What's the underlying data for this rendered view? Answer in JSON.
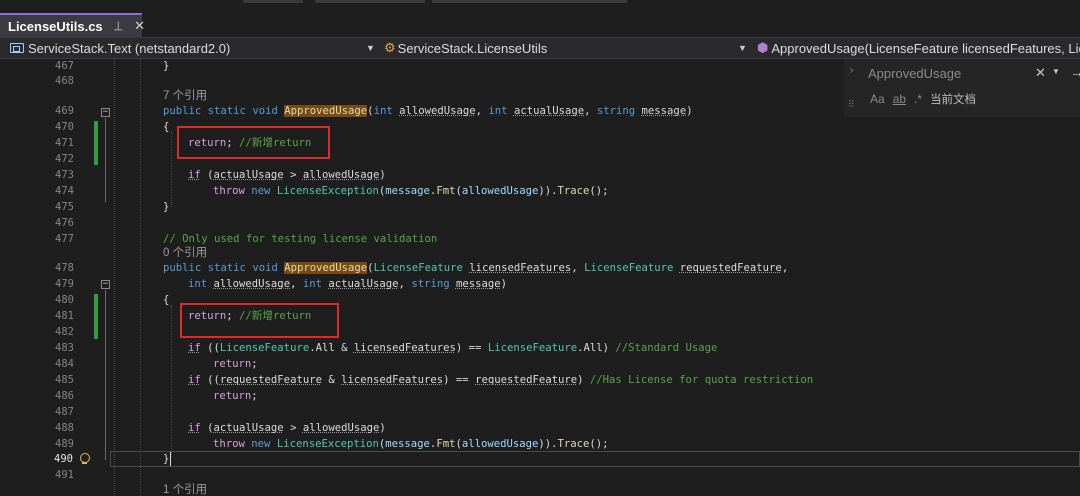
{
  "tab": {
    "title": "LicenseUtils.cs",
    "pin_icon": "pin-icon",
    "close_glyph": "✕"
  },
  "navbar": {
    "project": "ServiceStack.Text (netstandard2.0)",
    "type": "ServiceStack.LicenseUtils",
    "member": "ApprovedUsage(LicenseFeature licensedFeatures, Lic"
  },
  "find_widget": {
    "value": "ApprovedUsage",
    "scope": "当前文档",
    "opt_case": "Aa",
    "opt_word": "ab"
  },
  "code_lines": [
    {
      "num": "467",
      "text": "}",
      "kind": "brace"
    },
    {
      "num": "468",
      "text": "",
      "kind": "blank"
    },
    {
      "lens": "7 个引用"
    },
    {
      "num": "469",
      "text": "public static void ApprovedUsage(int allowedUsage, int actualUsage, string message)"
    },
    {
      "num": "470",
      "text": "{"
    },
    {
      "num": "471",
      "text": "return; //新增return"
    },
    {
      "num": "472",
      "text": ""
    },
    {
      "num": "473",
      "text": "if (actualUsage > allowedUsage)"
    },
    {
      "num": "474",
      "text": "throw new LicenseException(message.Fmt(allowedUsage)).Trace();"
    },
    {
      "num": "475",
      "text": "}"
    },
    {
      "num": "476",
      "text": ""
    },
    {
      "num": "477",
      "text": "// Only used for testing license validation"
    },
    {
      "lens": "0 个引用"
    },
    {
      "num": "478",
      "text": "public static void ApprovedUsage(LicenseFeature licensedFeatures, LicenseFeature requestedFeature,"
    },
    {
      "num": "479",
      "text": "int allowedUsage, int actualUsage, string message)"
    },
    {
      "num": "480",
      "text": "{"
    },
    {
      "num": "481",
      "text": "return; //新增return"
    },
    {
      "num": "482",
      "text": ""
    },
    {
      "num": "483",
      "text": "if ((LicenseFeature.All & licensedFeatures) == LicenseFeature.All) //Standard Usage"
    },
    {
      "num": "484",
      "text": "return;"
    },
    {
      "num": "485",
      "text": "if ((requestedFeature & licensedFeatures) == requestedFeature) //Has License for quota restriction"
    },
    {
      "num": "486",
      "text": "return;"
    },
    {
      "num": "487",
      "text": ""
    },
    {
      "num": "488",
      "text": "if (actualUsage > allowedUsage)"
    },
    {
      "num": "489",
      "text": "throw new LicenseException(message.Fmt(allowedUsage)).Trace();"
    },
    {
      "num": "490",
      "text": "}"
    },
    {
      "num": "491",
      "text": ""
    },
    {
      "lens": "1 个引用"
    }
  ],
  "colors": {
    "modified_bar": "#2ea043",
    "annotation_box": "#e02a2a",
    "find_highlight": "#7a4a16",
    "keyword": "#569cd6",
    "type": "#4ec9b0",
    "comment": "#57a64a"
  },
  "icons": {
    "project": "csharp-project-icon",
    "class": "class-icon",
    "method": "method-icon",
    "lightbulb": "lightbulb-icon"
  }
}
